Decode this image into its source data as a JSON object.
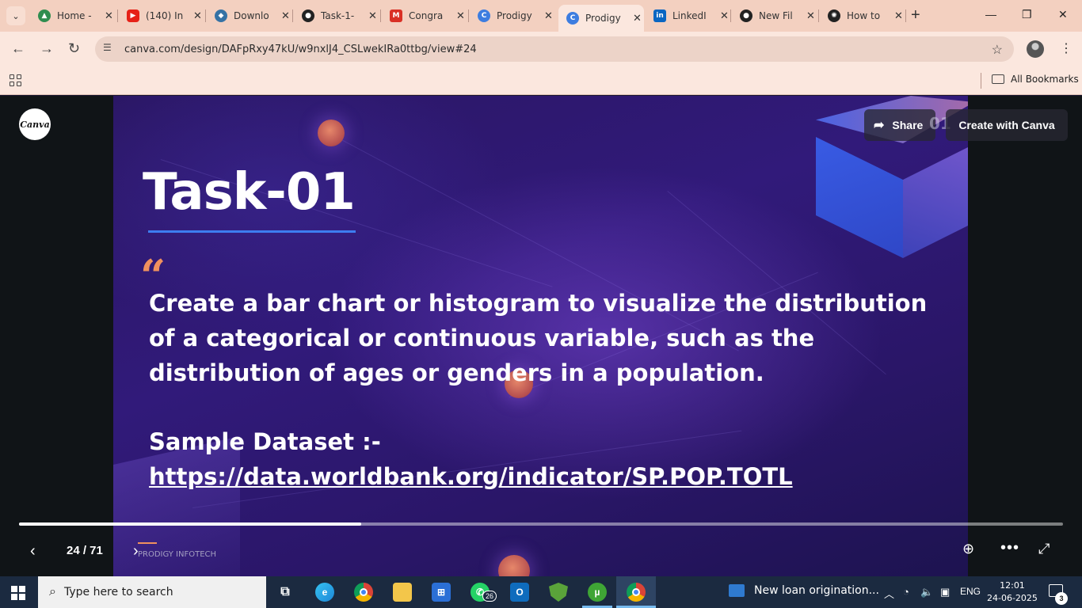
{
  "browser": {
    "tabs": [
      {
        "title": "Home -",
        "favicon_color": "#2f8d4f",
        "favicon_icon": "drive-icon"
      },
      {
        "title": "(140) In",
        "favicon_color": "#e62117",
        "favicon_icon": "youtube-icon"
      },
      {
        "title": "Downlo",
        "favicon_color": "#3572a5",
        "favicon_icon": "python-icon"
      },
      {
        "title": "Task-1-",
        "favicon_color": "#222222",
        "favicon_icon": "github-icon"
      },
      {
        "title": "Congra",
        "favicon_color": "#d93025",
        "favicon_icon": "gmail-icon"
      },
      {
        "title": "Prodigy",
        "favicon_color": "#3d7de0",
        "favicon_icon": "canva-icon"
      },
      {
        "title": "Prodigy",
        "favicon_color": "#3d7de0",
        "favicon_icon": "canva-icon"
      },
      {
        "title": "LinkedI",
        "favicon_color": "#0a66c2",
        "favicon_icon": "linkedin-icon"
      },
      {
        "title": "New Fil",
        "favicon_color": "#222222",
        "favicon_icon": "github-icon"
      },
      {
        "title": "How to",
        "favicon_color": "#222222",
        "favicon_icon": "openai-icon"
      }
    ],
    "active_tab_index": 6,
    "url": "canva.com/design/DAFpRxy47kU/w9nxlJ4_CSLwekIRa0ttbg/view#24",
    "bookmarks_label": "All Bookmarks"
  },
  "viewer": {
    "logo_text": "Canva",
    "share_label": "Share",
    "page_ghost_label": "01",
    "create_label": "Create with Canva",
    "page_count": "24 / 71",
    "progress": 0.328,
    "footer_brand": "PRODIGY INFOTECH"
  },
  "slide": {
    "title": "Task-01",
    "quote_mark": "“",
    "body": "Create a bar chart or histogram to visualize the distribution of a categorical or continuous variable, such as the distribution of ages or genders in a population.",
    "dataset_label": "Sample Dataset :-",
    "dataset_link": "https://data.worldbank.org/indicator/SP.POP.TOTL"
  },
  "taskbar": {
    "search_placeholder": "Type here to search",
    "whatsapp_badge": "26",
    "notification_text": "New loan origination...",
    "language": "ENG",
    "time": "12:01",
    "date": "24-06-2025",
    "action_center_badge": "3"
  }
}
